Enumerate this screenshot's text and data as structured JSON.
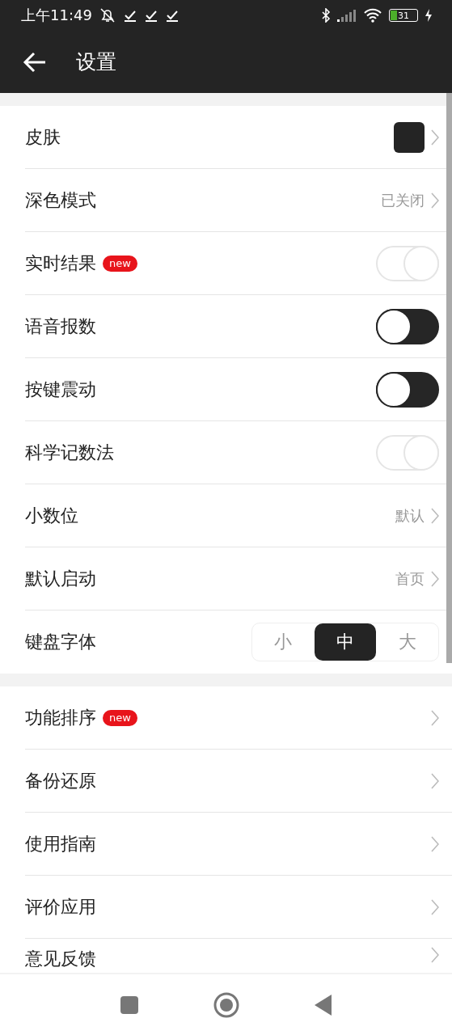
{
  "status_bar": {
    "time": "上午11:49",
    "battery": "31"
  },
  "app_bar": {
    "title": "设置"
  },
  "sections": [
    {
      "rows": [
        {
          "kind": "swatch",
          "label": "皮肤"
        },
        {
          "kind": "value",
          "label": "深色模式",
          "value": "已关闭"
        },
        {
          "kind": "toggle",
          "label": "实时结果",
          "badge": "new",
          "on": true
        },
        {
          "kind": "toggle",
          "label": "语音报数",
          "on": false
        },
        {
          "kind": "toggle",
          "label": "按键震动",
          "on": false
        },
        {
          "kind": "toggle",
          "label": "科学记数法",
          "on": true
        },
        {
          "kind": "value",
          "label": "小数位",
          "value": "默认"
        },
        {
          "kind": "value",
          "label": "默认启动",
          "value": "首页"
        },
        {
          "kind": "segmented",
          "label": "键盘字体",
          "options": [
            {
              "label": "小",
              "selected": false
            },
            {
              "label": "中",
              "selected": true
            },
            {
              "label": "大",
              "selected": false
            }
          ]
        }
      ]
    },
    {
      "rows": [
        {
          "kind": "link",
          "label": "功能排序",
          "badge": "new"
        },
        {
          "kind": "link",
          "label": "备份还原"
        },
        {
          "kind": "link",
          "label": "使用指南"
        },
        {
          "kind": "link",
          "label": "评价应用"
        },
        {
          "kind": "link",
          "label": "意见反馈"
        }
      ]
    }
  ]
}
